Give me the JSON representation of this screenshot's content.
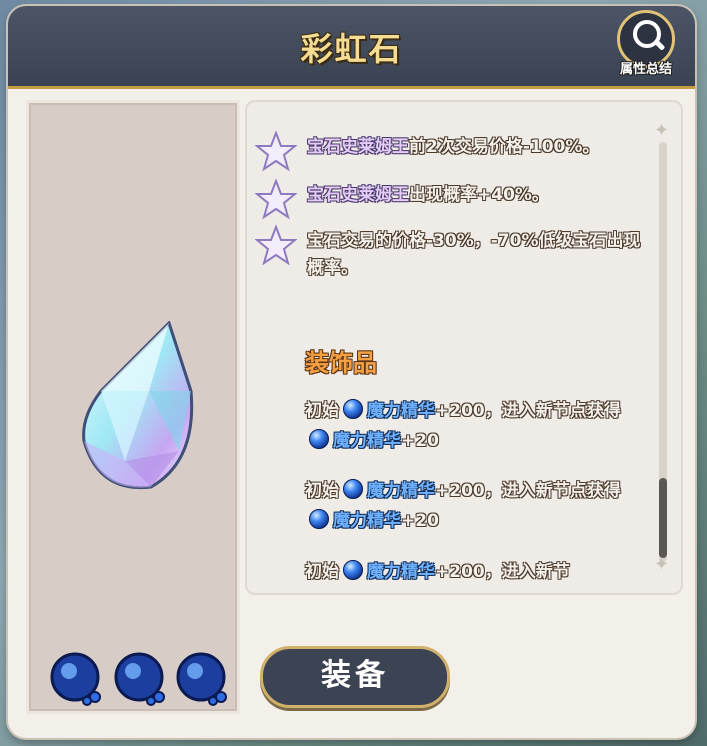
{
  "header": {
    "title": "彩虹石",
    "summary_label": "属性总结"
  },
  "effects": [
    {
      "highlight": "宝石史莱姆王",
      "text": "前2次交易价格-100%。"
    },
    {
      "highlight": "宝石史莱姆王",
      "text": "出现概率+40%。"
    },
    {
      "highlight": "",
      "text": "宝石交易的价格-30%，-70%低级宝石出现概率。"
    }
  ],
  "decoration": {
    "title": "装饰品",
    "entries": [
      {
        "prefix": "初始",
        "item1": "魔力精华",
        "mid": "+200，进入新节点获得",
        "item2": "魔力精华",
        "suffix": "+20"
      },
      {
        "prefix": "初始",
        "item1": "魔力精华",
        "mid": "+200，进入新节点获得",
        "item2": "魔力精华",
        "suffix": "+20"
      },
      {
        "prefix": "初始",
        "item1": "魔力精华",
        "mid": "+200，进入新节",
        "item2": "",
        "suffix": ""
      }
    ]
  },
  "slots": [
    "blue-gem-icon",
    "blue-gem-icon",
    "blue-gem-icon"
  ],
  "equip_button": {
    "label": "装备"
  },
  "colors": {
    "title": "#f5dc93",
    "header_bg": "#3a4352",
    "accent_gold": "#c79b43",
    "section_orange": "#f4a043",
    "item_blue": "#6fb2ff"
  }
}
